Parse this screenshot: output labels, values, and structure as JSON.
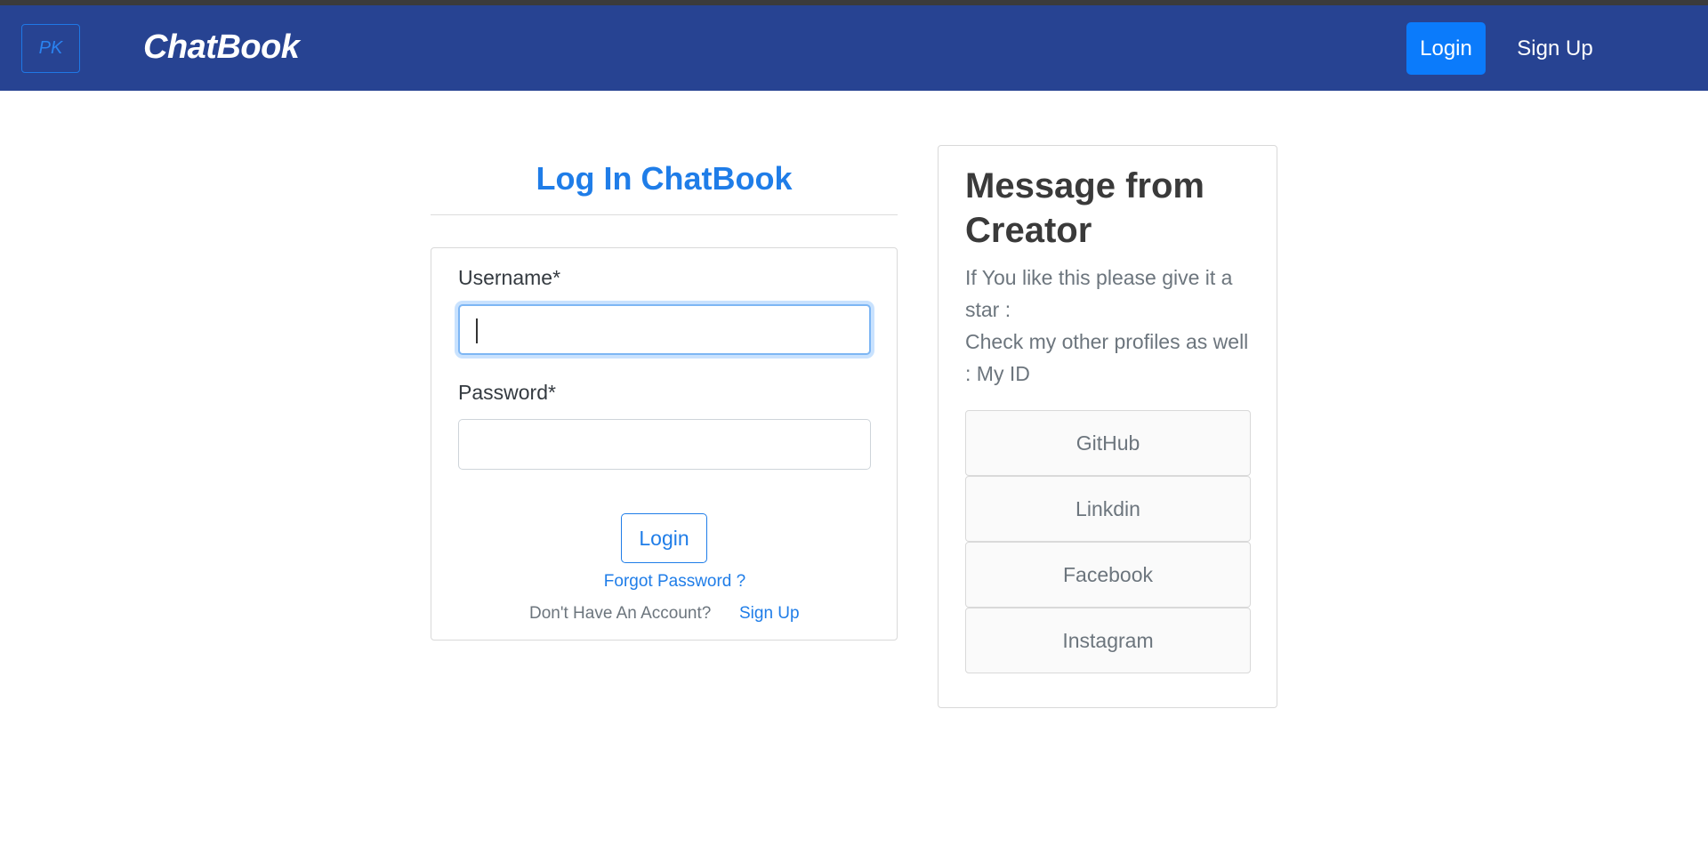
{
  "navbar": {
    "brand_badge": "PK",
    "brand_name": "ChatBook",
    "login_label": "Login",
    "signup_label": "Sign Up"
  },
  "login": {
    "title": "Log In ChatBook",
    "username_label": "Username*",
    "password_label": "Password*",
    "username_value": "",
    "password_value": "",
    "submit_label": "Login",
    "forgot_label": "Forgot Password ?",
    "no_account_text": "Don't Have An Account?",
    "signup_label": "Sign Up"
  },
  "creator": {
    "title": "Message from Creator",
    "line1": "If You like this please give it a star :",
    "line2": "Check my other profiles as well : My ID",
    "links": [
      "GitHub",
      "Linkdin",
      "Facebook",
      "Instagram"
    ]
  },
  "colors": {
    "navbar_bg": "#274392",
    "primary": "#0b7bfb",
    "link": "#1f7de8"
  }
}
